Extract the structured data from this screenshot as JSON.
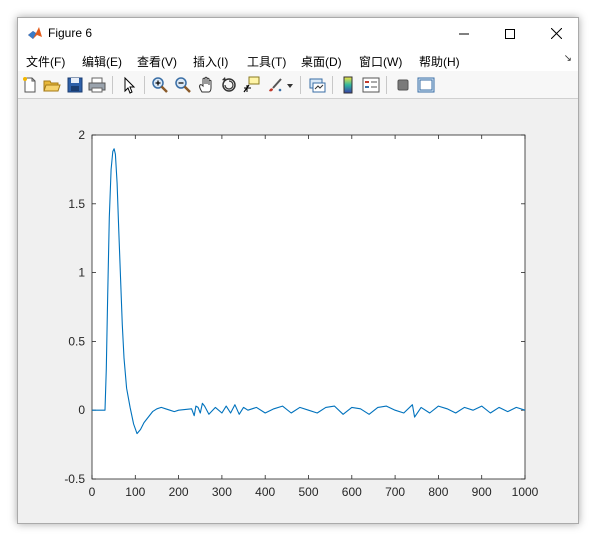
{
  "window": {
    "title": "Figure 6"
  },
  "menu": {
    "items": [
      "文件(F)",
      "编辑(E)",
      "查看(V)",
      "插入(I)",
      "工具(T)",
      "桌面(D)",
      "窗口(W)",
      "帮助(H)"
    ],
    "overflow_glyph": "↘"
  },
  "toolbar": {
    "icons": [
      "new-figure-icon",
      "open-file-icon",
      "save-icon",
      "print-icon",
      "select-arrow-icon",
      "zoom-in-icon",
      "zoom-out-icon",
      "pan-hand-icon",
      "rotate-3d-icon",
      "data-cursor-icon",
      "brush-icon",
      "brush-dropdown-icon",
      "link-plot-icon",
      "colorbar-icon",
      "legend-icon",
      "hide-plot-tools-icon",
      "show-plot-tools-icon"
    ]
  },
  "chart_data": {
    "type": "line",
    "title": "",
    "xlabel": "",
    "ylabel": "",
    "xlim": [
      0,
      1000
    ],
    "ylim": [
      -0.5,
      2
    ],
    "xticks": [
      "0",
      "100",
      "200",
      "300",
      "400",
      "500",
      "600",
      "700",
      "800",
      "900",
      "1000"
    ],
    "yticks": [
      "-0.5",
      "0",
      "0.5",
      "1",
      "1.5",
      "2"
    ],
    "grid": false,
    "color": "#0072BD",
    "series": [
      {
        "x": [
          0,
          30,
          33,
          36,
          40,
          44,
          48,
          51,
          54,
          58,
          62,
          66,
          70,
          74,
          80,
          88,
          96,
          104,
          112,
          120,
          130,
          140,
          150,
          160,
          170,
          180,
          190,
          200,
          230,
          236,
          240,
          245,
          250,
          255,
          260,
          270,
          285,
          300,
          310,
          320,
          330,
          340,
          350,
          360,
          380,
          400,
          420,
          440,
          460,
          480,
          500,
          520,
          540,
          560,
          580,
          600,
          620,
          640,
          660,
          680,
          700,
          720,
          740,
          745,
          760,
          780,
          800,
          820,
          840,
          860,
          880,
          900,
          920,
          940,
          960,
          980,
          1000
        ],
        "y": [
          0,
          0,
          0.3,
          0.8,
          1.4,
          1.75,
          1.88,
          1.9,
          1.86,
          1.65,
          1.3,
          0.95,
          0.62,
          0.38,
          0.16,
          0.02,
          -0.1,
          -0.17,
          -0.14,
          -0.09,
          -0.05,
          -0.01,
          0.01,
          0.02,
          0.01,
          0.0,
          -0.01,
          0.0,
          0.01,
          -0.04,
          0.03,
          0.02,
          -0.02,
          0.05,
          0.03,
          -0.03,
          0.02,
          -0.02,
          0.03,
          -0.02,
          0.04,
          -0.03,
          0.02,
          0.0,
          0.02,
          -0.02,
          0.01,
          0.03,
          -0.02,
          0.02,
          0.0,
          -0.02,
          0.02,
          0.03,
          -0.03,
          0.02,
          0.01,
          -0.03,
          0.02,
          0.03,
          0.0,
          -0.02,
          0.04,
          -0.05,
          0.02,
          -0.02,
          0.03,
          0.01,
          -0.02,
          0.02,
          0.0,
          0.03,
          -0.02,
          0.02,
          -0.01,
          0.02,
          0.0
        ]
      }
    ]
  }
}
